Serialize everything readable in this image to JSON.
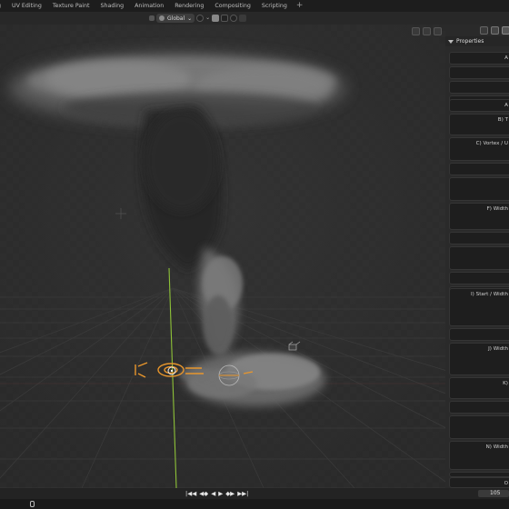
{
  "workspace_tabs": [
    "g",
    "UV Editing",
    "Texture Paint",
    "Shading",
    "Animation",
    "Rendering",
    "Compositing",
    "Scripting",
    "+"
  ],
  "header": {
    "orientation": "Global",
    "icons": [
      "global-transform-icon",
      "pivot-icon",
      "snap-icon",
      "proportional-edit-icon"
    ]
  },
  "panel": {
    "title": "Properties",
    "fields": [
      "A",
      "",
      "",
      "",
      "A",
      "B) T",
      "C) Vortex / U",
      "",
      "",
      "F) Width",
      "",
      "",
      "",
      "",
      "I) Start / Width",
      "",
      "J) Width",
      "K)",
      "",
      "",
      "N) Width",
      "",
      "O"
    ]
  },
  "timeline": {
    "controls": [
      "|◀◀",
      "◀◆",
      "◀",
      "▶",
      "◆▶",
      "▶▶|"
    ],
    "current_frame": "105"
  },
  "colors": {
    "accent": "#e8962c",
    "y_axis": "#8ec238",
    "grid": "#3c3c3c",
    "smoke": "#7a7a7a"
  }
}
